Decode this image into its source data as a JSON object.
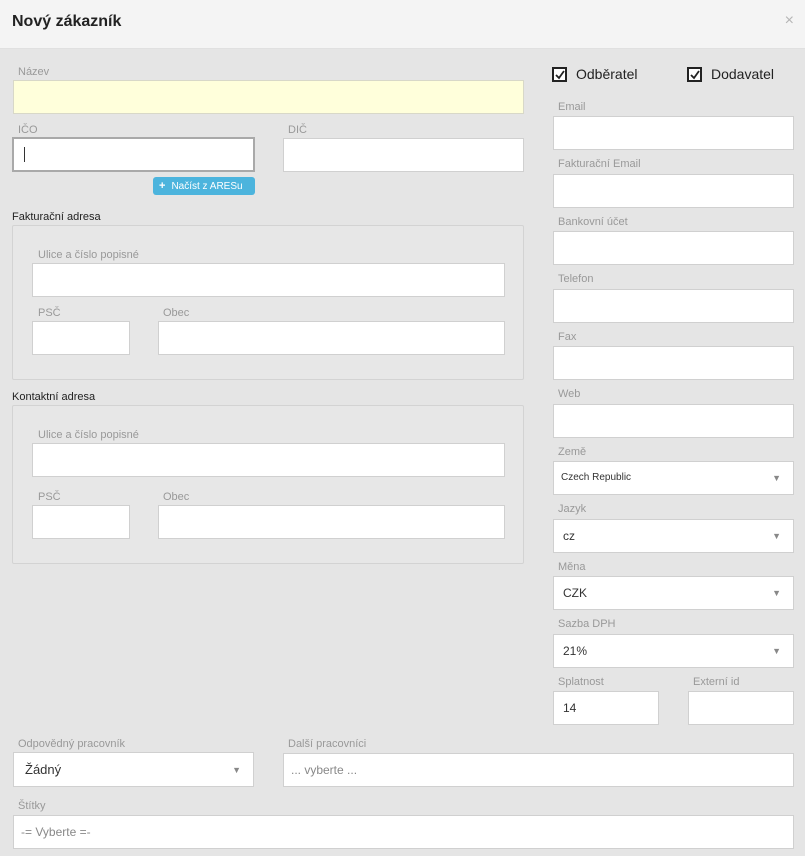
{
  "dialog": {
    "title": "Nový zákazník",
    "close": "×"
  },
  "left": {
    "nazev_label": "Název",
    "ico_label": "IČO",
    "dic_label": "DIČ",
    "ares_button": "Načíst z ARESu",
    "billing_title": "Fakturační adresa",
    "contact_title": "Kontaktní adresa",
    "street_label": "Ulice a číslo popisné",
    "psc_label": "PSČ",
    "obec_label": "Obec"
  },
  "right": {
    "odberatel": "Odběratel",
    "dodavatel": "Dodavatel",
    "email": "Email",
    "fakt_email": "Fakturační Email",
    "bank": "Bankovní účet",
    "telefon": "Telefon",
    "fax": "Fax",
    "web": "Web",
    "zeme_label": "Země",
    "zeme_value": "Czech Republic",
    "jazyk_label": "Jazyk",
    "jazyk_value": "cz",
    "mena_label": "Měna",
    "mena_value": "CZK",
    "dph_label": "Sazba DPH",
    "dph_value": "21%",
    "splatnost_label": "Splatnost",
    "splatnost_value": "14",
    "externi_label": "Externí id"
  },
  "bottom": {
    "odpovedny_label": "Odpovědný pracovník",
    "odpovedny_value": "Žádný",
    "dalsi_label": "Další pracovníci",
    "dalsi_placeholder": "... vyberte ...",
    "stitky_label": "Štítky",
    "stitky_placeholder": "-= Vyberte =-"
  },
  "icons": {
    "dropdown": "▼",
    "plus": "+"
  }
}
